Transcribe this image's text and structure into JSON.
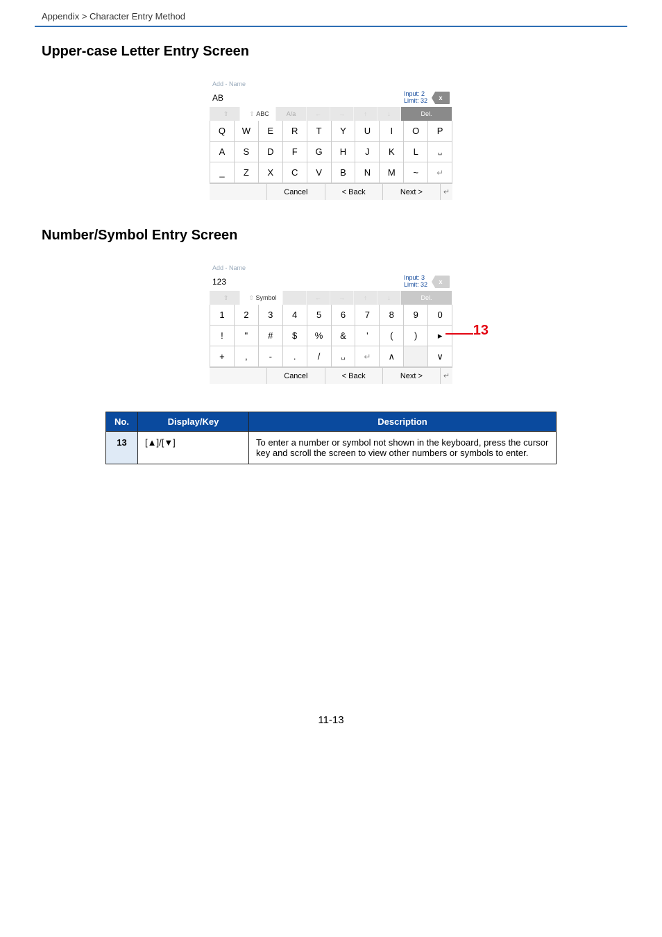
{
  "breadcrumb": "Appendix > Character Entry Method",
  "section1_title": "Upper-case Letter Entry Screen",
  "section2_title": "Number/Symbol Entry Screen",
  "kbdA": {
    "window_title": "Add - Name",
    "value": "AB",
    "input_label": "Input:",
    "input_n": "2",
    "limit_label": "Limit:",
    "limit_n": "32",
    "backspace": "x",
    "tabs": {
      "abc": "ABC",
      "aa": "A/a",
      "del": "Del."
    },
    "rows": [
      [
        "Q",
        "W",
        "E",
        "R",
        "T",
        "Y",
        "U",
        "I",
        "O",
        "P"
      ],
      [
        "A",
        "S",
        "D",
        "F",
        "G",
        "H",
        "J",
        "K",
        "L",
        "␣"
      ],
      [
        "_",
        "Z",
        "X",
        "C",
        "V",
        "B",
        "N",
        "M",
        "~",
        "↵"
      ]
    ],
    "cancel": "Cancel",
    "back": "< Back",
    "next": "Next >"
  },
  "kbdB": {
    "window_title": "Add - Name",
    "value": "123",
    "input_label": "Input:",
    "input_n": "3",
    "limit_label": "Limit:",
    "limit_n": "32",
    "backspace": "x",
    "tabs": {
      "symbol": "Symbol",
      "del": "Del."
    },
    "rows": [
      [
        "1",
        "2",
        "3",
        "4",
        "5",
        "6",
        "7",
        "8",
        "9",
        "0"
      ],
      [
        "!",
        "\"",
        "#",
        "$",
        "%",
        "&",
        "'",
        "(",
        ")",
        "▸"
      ],
      [
        "+",
        ",",
        "-",
        ".",
        "/",
        "␣",
        "↵",
        "∧"
      ]
    ],
    "cancel": "Cancel",
    "back": "< Back",
    "next": "Next >"
  },
  "callout_13": "13",
  "table": {
    "hdr_no": "No.",
    "hdr_dk": "Display/Key",
    "hdr_desc": "Description",
    "row_no": "13",
    "row_dk": "[▲]/[▼]",
    "row_desc": "To enter a number or symbol not shown in the keyboard, press the cursor key and scroll the screen to view other numbers or symbols to enter."
  },
  "page_number": "11-13"
}
